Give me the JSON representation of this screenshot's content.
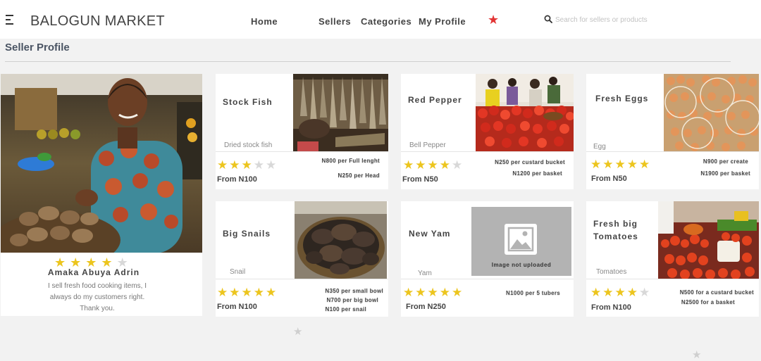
{
  "header": {
    "brand": "BALOGUN MARKET",
    "nav": [
      "Home",
      "Sellers",
      "Categories",
      "My Profile"
    ],
    "search_placeholder": "Search for sellers or products"
  },
  "page": {
    "title": "Seller Profile"
  },
  "seller": {
    "name": "Amaka Abuya Adrin",
    "rating": 4,
    "bio": [
      "I sell fresh food cooking items, I",
      "always do my customers right.",
      "Thank you."
    ]
  },
  "products": [
    {
      "name": [
        "Stock Fish"
      ],
      "subtitle": "Dried stock fish",
      "rating": 3,
      "from": "From N100",
      "prices": [
        "N800 per Full lenght",
        "N250 per Head"
      ]
    },
    {
      "name": [
        "Red Pepper"
      ],
      "subtitle": "Bell Pepper",
      "rating": 4,
      "from": "From N50",
      "prices": [
        "N250 per custard bucket",
        "N1200 per basket"
      ]
    },
    {
      "name": [
        "Fresh Eggs"
      ],
      "subtitle": "Egg",
      "rating": 5,
      "from": "From N50",
      "prices": [
        "N900 per create",
        "N1900 per basket"
      ]
    },
    {
      "name": [
        "Big Snails"
      ],
      "subtitle": "Snail",
      "rating": 5,
      "from": "From N100",
      "prices": [
        "N350 per small bowl",
        "N700 per big bowl",
        "N100 per snail"
      ]
    },
    {
      "name": [
        "New Yam"
      ],
      "subtitle": "Yam",
      "rating": 5,
      "from": "From N250",
      "prices": [
        "N1000 per 5 tubers"
      ],
      "image_placeholder": "Image not uploaded"
    },
    {
      "name": [
        "Fresh big",
        "Tomatoes"
      ],
      "subtitle": "Tomatoes",
      "rating": 4,
      "from": "From N100",
      "prices": [
        "N500 for a custard bucket",
        "N2500 for a basket"
      ]
    }
  ],
  "colors": {
    "star_on": "#ecc51e",
    "star_off": "#d8d8d8",
    "favorite": "#e23434",
    "brand_text": "#444444"
  }
}
